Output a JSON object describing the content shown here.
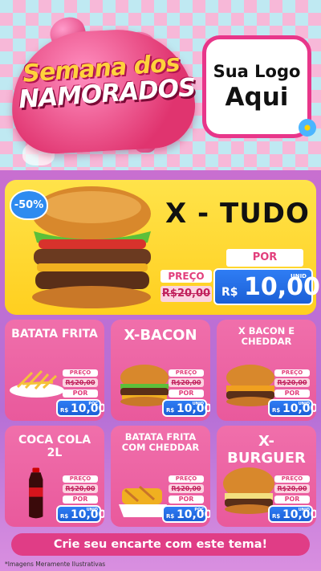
{
  "header": {
    "title_line1": "Semana dos",
    "title_line2": "NAMORADOS",
    "logo_line1": "Sua Logo",
    "logo_line2": "Aqui"
  },
  "featured": {
    "discount": "-50%",
    "name": "X - TUDO",
    "preco_label": "PREÇO",
    "old_price": "R$20,00",
    "por_label": "POR",
    "currency": "R$",
    "price": "10,00",
    "unit": "UNID"
  },
  "products": [
    {
      "name": "BATATA FRITA",
      "preco_label": "PREÇO",
      "old_price": "R$20,00",
      "por_label": "POR",
      "currency": "R$",
      "price": "10,00",
      "unit": "POÇ"
    },
    {
      "name": "X-BACON",
      "preco_label": "PREÇO",
      "old_price": "R$20,00",
      "por_label": "POR",
      "currency": "R$",
      "price": "10,00",
      "unit": "UNID"
    },
    {
      "name": "X BACON E CHEDDAR",
      "preco_label": "PREÇO",
      "old_price": "R$20,00",
      "por_label": "POR",
      "currency": "R$",
      "price": "10,00",
      "unit": "UNID"
    },
    {
      "name": "COCA COLA 2L",
      "preco_label": "PREÇO",
      "old_price": "R$20,00",
      "por_label": "POR",
      "currency": "R$",
      "price": "10,00",
      "unit": "UNID"
    },
    {
      "name": "BATATA FRITA COM CHEDDAR",
      "preco_label": "PREÇO",
      "old_price": "R$20,00",
      "por_label": "POR",
      "currency": "R$",
      "price": "10,00",
      "unit": "POÇ"
    },
    {
      "name": "X-BURGUER",
      "preco_label": "PREÇO",
      "old_price": "R$20,00",
      "por_label": "POR",
      "currency": "R$",
      "price": "10,00",
      "unit": "UNID"
    }
  ],
  "banner": "Crie seu encarte com este tema!",
  "footnote": "*Imagens Meramente Ilustrativas"
}
